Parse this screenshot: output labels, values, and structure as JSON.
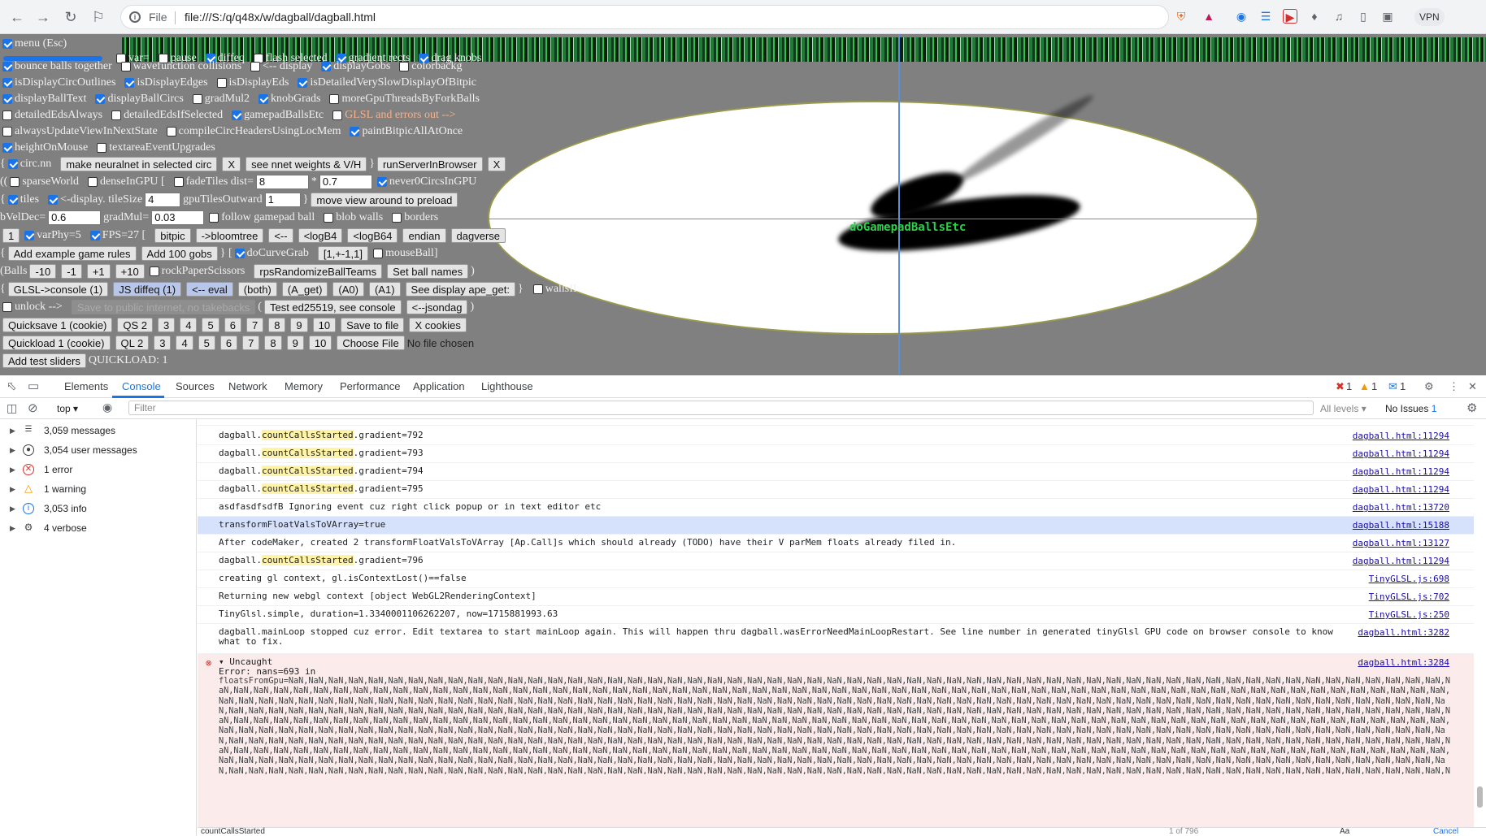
{
  "browser": {
    "file_word": "File",
    "url": "file:///S:/q/q48x/w/dagball/dagball.html",
    "vpn": "VPN"
  },
  "controls": {
    "menu": "menu (Esc)",
    "row1": {
      "var": "var=",
      "pause": "pause",
      "diffeq": "diffeq",
      "flash": "flash selected",
      "gradient": "gradient rects",
      "drag": "drag knobs"
    },
    "row2": {
      "bounce": "bounce balls together",
      "wavefunction": "wavefunction collisions",
      "display": "<-- display",
      "displayGobs": "displayGobs",
      "colorbackg": "colorbackg"
    },
    "row3": {
      "circOutlines": "isDisplayCircOutlines",
      "edges": "isDisplayEdges",
      "eds": "isDisplayEds",
      "detailed": "isDetailedVerySlowDisplayOfBitpic"
    },
    "row4": {
      "ballText": "displayBallText",
      "ballCircs": "displayBallCircs",
      "gradMul2": "gradMul2",
      "knobGrads": "knobGrads",
      "moreGpu": "moreGpuThreadsByForkBalls"
    },
    "row5": {
      "detailedEds": "detailedEdsAlways",
      "detailedSel": "detailedEdsIfSelected",
      "gamepad": "gamepadBallsEtc",
      "glsl": "GLSL and errors out -->"
    },
    "row6": {
      "always": "alwaysUpdateViewInNextState",
      "compile": "compileCircHeadersUsingLocMem",
      "paint": "paintBitpicAllAtOnce"
    },
    "row7": {
      "height": "heightOnMouse",
      "textarea": "textareaEventUpgrades"
    },
    "row8": {
      "brace": "{",
      "circnn": "circ.nn",
      "make": "make neuralnet in selected circ",
      "x1": "X",
      "see": "see nnet weights & V/H",
      "brace2": "}",
      "run": "runServerInBrowser",
      "x2": "X"
    },
    "row9": {
      "pre": "((",
      "sparse": "sparseWorld",
      "dense": "denseInGPU [",
      "fade": "fadeTiles dist=",
      "fade_val": "8",
      "star": "*",
      "mul_val": "0.7",
      "never": "never0CircsInGPU"
    },
    "row10": {
      "brace": "{",
      "tiles": "tiles",
      "display": "<-display. tileSize",
      "tile_val": "4",
      "gpuTiles": "gpuTilesOutward",
      "gpu_val": "1",
      "close": "}",
      "move": "move view around to preload"
    },
    "row11": {
      "velDec": "bVelDec=",
      "vel_val": "0.6",
      "gradMul": "gradMul=",
      "grad_val": "0.03",
      "follow": "follow gamepad ball",
      "blob": "blob walls",
      "borders": "borders"
    },
    "row12": {
      "one": "1",
      "varPhy": "varPhy=5",
      "fps": "FPS=27 [",
      "bitpic": "bitpic",
      "bloom": "->bloomtree",
      "back": "<--",
      "logB4": "<logB4",
      "logB64": "<logB64",
      "endian": "endian",
      "dagverse": "dagverse"
    },
    "row13": {
      "brace": "{",
      "addGame": "Add example game rules",
      "add100": "Add 100 gobs",
      "mid": "} [",
      "curve": "doCurveGrab",
      "range": "[1,+-1,1]",
      "mouse": "mouseBall",
      "close": "]"
    },
    "row14": {
      "balls": "(Balls",
      "m10": "-10",
      "m1": "-1",
      "p1": "+1",
      "p10": "+10",
      "rps": "rockPaperScissors",
      "rpsBtn": "rpsRandomizeBallTeams",
      "setNames": "Set ball names",
      "close": ")"
    },
    "row15": {
      "brace": "{",
      "glslConsole": "GLSL->console (1)",
      "jsDiffeq": "JS diffeq (1)",
      "eval": "<-- eval",
      "both": "(both)",
      "aget": "(A_get)",
      "a0": "(A0)",
      "a1": "(A1)",
      "seeDisplay": "See display ape_get:",
      "close": "}",
      "walls": "wallsII"
    },
    "row16": {
      "unlock": "unlock -->",
      "save": "Save to public internet, no takebacks",
      "paren": "(",
      "test": "Test ed25519, see console",
      "json": "<--jsondag",
      "close": ")"
    },
    "row17": {
      "qs1": "Quicksave 1 (cookie)",
      "qs2": "QS 2",
      "n3": "3",
      "n4": "4",
      "n5": "5",
      "n6": "6",
      "n7": "7",
      "n8": "8",
      "n9": "9",
      "n10": "10",
      "saveFile": "Save to file",
      "xcookies": "X cookies"
    },
    "row18": {
      "ql1": "Quickload 1 (cookie)",
      "ql2": "QL 2",
      "n3": "3",
      "n4": "4",
      "n5": "5",
      "n6": "6",
      "n7": "7",
      "n8": "8",
      "n9": "9",
      "n10": "10",
      "choose": "Choose File",
      "nofile": "No file chosen"
    },
    "row19": {
      "addTest": "Add test sliders",
      "quickload": "QUICKLOAD: 1"
    },
    "canvas_text": "doGamepadBallsEtc"
  },
  "devtools": {
    "tabs": [
      "Elements",
      "Console",
      "Sources",
      "Network",
      "Memory",
      "Performance",
      "Application",
      "Lighthouse"
    ],
    "counts": {
      "errors": "1",
      "warnings": "1",
      "info": "1"
    },
    "context": "top",
    "filter_placeholder": "Filter",
    "levels": "All levels",
    "issues": "No Issues",
    "issues_count": "1"
  },
  "sidebar": [
    {
      "label": "3,059 messages",
      "icon": "list-icon"
    },
    {
      "label": "3,054 user messages",
      "icon": "user-icon"
    },
    {
      "label": "1 error",
      "icon": "error-icon"
    },
    {
      "label": "1 warning",
      "icon": "warning-icon"
    },
    {
      "label": "3,053 info",
      "icon": "info-icon"
    },
    {
      "label": "4 verbose",
      "icon": "bug-icon"
    }
  ],
  "console": {
    "rows": [
      {
        "pre": "dagball.",
        "mark": "countCallsStarted",
        "post": ".gradient=792",
        "src": "dagball.html:11294"
      },
      {
        "pre": "dagball.",
        "mark": "countCallsStarted",
        "post": ".gradient=793",
        "src": "dagball.html:11294"
      },
      {
        "pre": "dagball.",
        "mark": "countCallsStarted",
        "post": ".gradient=794",
        "src": "dagball.html:11294"
      },
      {
        "pre": "dagball.",
        "mark": "countCallsStarted",
        "post": ".gradient=795",
        "src": "dagball.html:11294"
      },
      {
        "pre": "asdfasdfsdfB Ignoring event cuz right click popup or in text editor etc",
        "mark": "",
        "post": "",
        "src": "dagball.html:13720"
      },
      {
        "pre": "transformFloatValsToVArray=true",
        "mark": "",
        "post": "",
        "src": "dagball.html:15188"
      },
      {
        "pre": "After codeMaker, created 2 transformFloatValsToVArray [Ap.Call]s which should already (TODO) have their V parMem floats already filed in.",
        "mark": "",
        "post": "",
        "src": "dagball.html:13127"
      },
      {
        "pre": "dagball.",
        "mark": "countCallsStarted",
        "post": ".gradient=796",
        "src": "dagball.html:11294"
      },
      {
        "pre": "creating gl context, gl.isContextLost()==false",
        "mark": "",
        "post": "",
        "src": "TinyGLSL.js:698"
      },
      {
        "pre": "Returning new webgl context [object WebGL2RenderingContext]",
        "mark": "",
        "post": "",
        "src": "TinyGLSL.js:702"
      },
      {
        "pre": "TinyGlsl.simple, duration=1.3340001106262207, now=1715881993.63",
        "mark": "",
        "post": "",
        "src": "TinyGLSL.js:250"
      },
      {
        "pre": "dagball.mainLoop stopped cuz error. Edit textarea to start mainLoop again. This will happen thru dagball.wasErrorNeedMainLoopRestart. See line number in generated tinyGlsl GPU code on browser console to know what to fix.",
        "mark": "",
        "post": "",
        "src": "dagball.html:3282"
      }
    ],
    "error": {
      "title": "▾ Uncaught",
      "line1": "Error: nans=693 in",
      "nan_prefix": "floatsFromGpu=",
      "nan_token": "NaN,",
      "nan_count": 1100,
      "src": "dagball.html:3284"
    },
    "search": "countCallsStarted",
    "search_count": "1 of 796",
    "cancel": "Cancel",
    "aa": "Aa"
  }
}
